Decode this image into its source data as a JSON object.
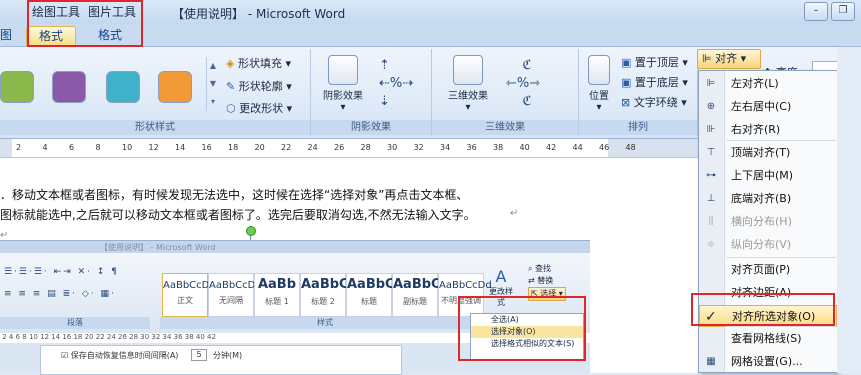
{
  "titlebar": {
    "context_draw": "绘图工具",
    "context_picture": "图片工具",
    "title": "【使用说明】 - Microsoft Word"
  },
  "tabs": {
    "format1": "格式",
    "format2": "格式"
  },
  "ribbon": {
    "shape_styles": {
      "label": "形状样式",
      "fill": "形状填充",
      "outline": "形状轮廓",
      "change_shape": "更改形状",
      "swatch_colors": [
        "#8ab84a",
        "#8a5aa8",
        "#3fb1c9",
        "#f29a3a"
      ]
    },
    "shadow": {
      "label": "阴影效果",
      "button": "阴影效果"
    },
    "threed": {
      "label": "三维效果",
      "button": "三维效果"
    },
    "arrange": {
      "label": "排列",
      "position": "位置",
      "bring_front": "置于顶层",
      "send_back": "置于底层",
      "text_wrap": "文字环绕",
      "align": "对齐",
      "height": "高度"
    }
  },
  "ruler": {
    "numbers": [
      "2",
      "4",
      "6",
      "8",
      "10",
      "12",
      "14",
      "16",
      "18",
      "20",
      "22",
      "24",
      "26",
      "28",
      "30",
      "32",
      "34",
      "36",
      "38",
      "40",
      "42",
      "44",
      "46",
      "48"
    ]
  },
  "document": {
    "line1": "．移动文本框或者图标，有时候发现无法选中，这时候在选择“选择对象”再点击文本框、",
    "line2": "图标就能选中,之后就可以移动文本框或者图标了。选完后要取消勾选,不然无法输入文字。"
  },
  "embedded": {
    "title": "【使用说明】 - Microsoft Word",
    "styles": [
      {
        "sample": "AaBbCcDd",
        "name": "正文"
      },
      {
        "sample": "AaBbCcDd",
        "name": "无间隔"
      },
      {
        "sample": "AaBb",
        "name": "标题 1"
      },
      {
        "sample": "AaBbC",
        "name": "标题 2"
      },
      {
        "sample": "AaBbC",
        "name": "标题"
      },
      {
        "sample": "AaBbC",
        "name": "副标题"
      },
      {
        "sample": "AaBbCcDd",
        "name": "不明显强调"
      }
    ],
    "group_paragraph": "段落",
    "group_styles": "样式",
    "change_styles": "更改样式",
    "find": "查找",
    "replace": "替换",
    "select": "选择",
    "menu": {
      "select_all": "全选(A)",
      "select_object": "选择对象(O)",
      "select_similar": "选择格式相似的文本(S)"
    },
    "checkbox_text": "保存自动恢复信息时间间隔(A)",
    "minutes_value": "5",
    "minutes_unit": "分钟(M)"
  },
  "align_menu": {
    "button": "对齐",
    "items": [
      {
        "label": "左对齐(L)",
        "icon": "align-left-icon",
        "glyph": "⊫",
        "disabled": false
      },
      {
        "label": "左右居中(C)",
        "icon": "align-center-icon",
        "glyph": "⊕",
        "disabled": false
      },
      {
        "label": "右对齐(R)",
        "icon": "align-right-icon",
        "glyph": "⊪",
        "disabled": false
      },
      {
        "label": "顶端对齐(T)",
        "icon": "align-top-icon",
        "glyph": "⊤",
        "disabled": false
      },
      {
        "label": "上下居中(M)",
        "icon": "align-middle-icon",
        "glyph": "⊶",
        "disabled": false
      },
      {
        "label": "底端对齐(B)",
        "icon": "align-bottom-icon",
        "glyph": "⊥",
        "disabled": false
      },
      {
        "label": "横向分布(H)",
        "icon": "distribute-horizontal-icon",
        "glyph": "⫼",
        "disabled": true
      },
      {
        "label": "纵向分布(V)",
        "icon": "distribute-vertical-icon",
        "glyph": "≑",
        "disabled": true
      },
      {
        "label": "对齐页面(P)",
        "icon": "align-page-icon",
        "glyph": "",
        "disabled": false
      },
      {
        "label": "对齐边距(A)",
        "icon": "align-margin-icon",
        "glyph": "",
        "disabled": false
      },
      {
        "label": "对齐所选对象(O)",
        "icon": "check-icon",
        "glyph": "✓",
        "disabled": false,
        "checked": true
      },
      {
        "label": "查看网格线(S)",
        "icon": "gridlines-icon",
        "glyph": "",
        "disabled": false
      },
      {
        "label": "网格设置(G)...",
        "icon": "grid-settings-icon",
        "glyph": "▦",
        "disabled": false
      }
    ]
  }
}
